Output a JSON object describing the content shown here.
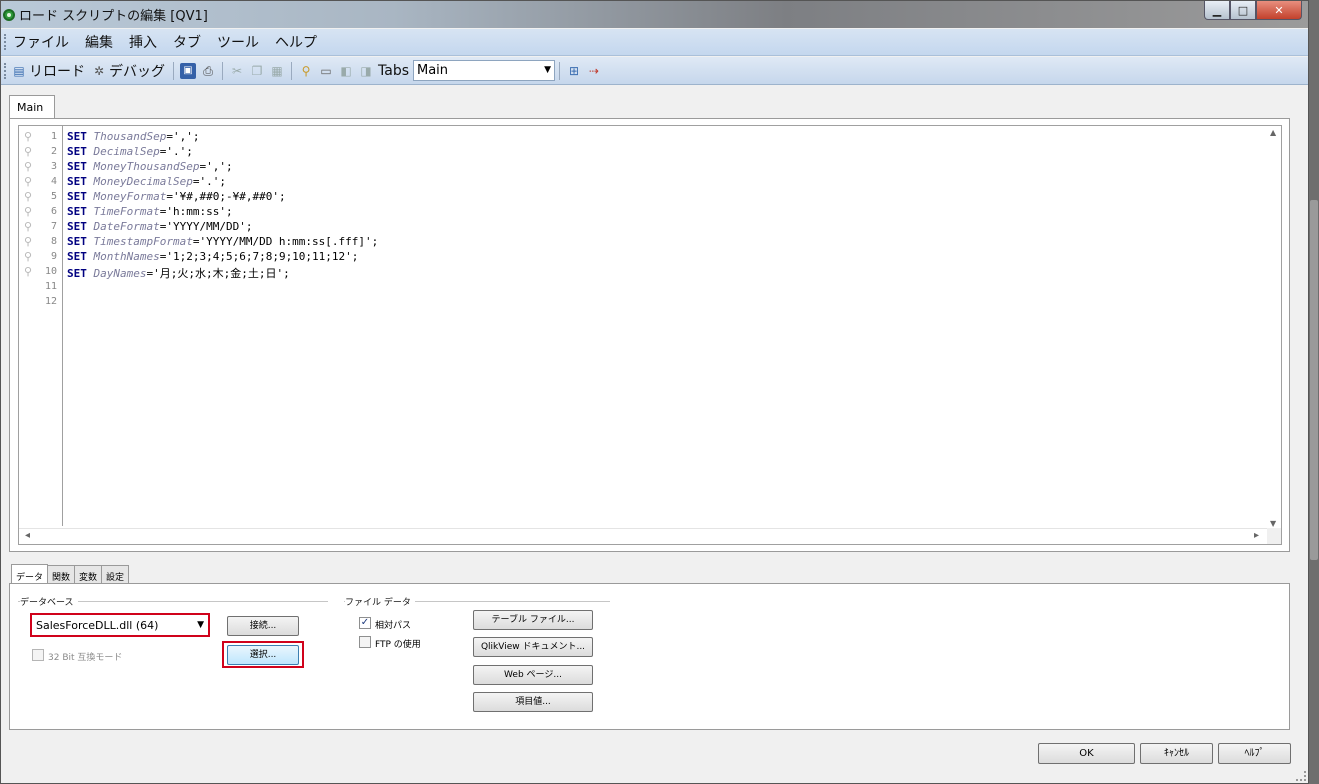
{
  "window": {
    "title": "ロード スクリプトの編集 [QV1]"
  },
  "menu": [
    "ファイル",
    "編集",
    "挿入",
    "タブ",
    "ツール",
    "ヘルプ"
  ],
  "toolbar": {
    "reload_label": "リロード",
    "debug_label": "デバッグ",
    "tabs_label": "Tabs",
    "tabs_selected": "Main"
  },
  "editor": {
    "tab_label": "Main",
    "lines": [
      {
        "num": "1",
        "kw": "SET",
        "var": "ThousandSep",
        "val": "=',';"
      },
      {
        "num": "2",
        "kw": "SET",
        "var": "DecimalSep",
        "val": "='.';"
      },
      {
        "num": "3",
        "kw": "SET",
        "var": "MoneyThousandSep",
        "val": "=',';"
      },
      {
        "num": "4",
        "kw": "SET",
        "var": "MoneyDecimalSep",
        "val": "='.';"
      },
      {
        "num": "5",
        "kw": "SET",
        "var": "MoneyFormat",
        "val": "='¥#,##0;-¥#,##0';"
      },
      {
        "num": "6",
        "kw": "SET",
        "var": "TimeFormat",
        "val": "='h:mm:ss';"
      },
      {
        "num": "7",
        "kw": "SET",
        "var": "DateFormat",
        "val": "='YYYY/MM/DD';"
      },
      {
        "num": "8",
        "kw": "SET",
        "var": "TimestampFormat",
        "val": "='YYYY/MM/DD h:mm:ss[.fff]';"
      },
      {
        "num": "9",
        "kw": "SET",
        "var": "MonthNames",
        "val": "='1;2;3;4;5;6;7;8;9;10;11;12';"
      },
      {
        "num": "10",
        "kw": "SET",
        "var": "DayNames",
        "val": "='月;火;水;木;金;土;日';"
      },
      {
        "num": "11",
        "kw": "",
        "var": "",
        "val": ""
      },
      {
        "num": "12",
        "kw": "",
        "var": "",
        "val": ""
      }
    ]
  },
  "bottom_tabs": [
    "データ",
    "関数",
    "変数",
    "設定"
  ],
  "data_panel": {
    "database_label": "データベース",
    "database_value": "SalesForceDLL.dll (64)",
    "connect_button": "接続...",
    "select_button": "選択...",
    "compat_mode_label": "32 Bit 互換モード",
    "file_data_label": "ファイル データ",
    "relative_path_label": "相対パス",
    "relative_path_checked": true,
    "ftp_label": "FTP の使用",
    "ftp_checked": false,
    "table_file_button": "テーブル ファイル...",
    "qlikview_doc_button": "QlikView ドキュメント...",
    "web_page_button": "Web ページ...",
    "field_value_button": "項目値..."
  },
  "dialog_buttons": {
    "ok": "OK",
    "cancel": "ｷｬﾝｾﾙ",
    "help": "ﾍﾙﾌﾟ"
  },
  "colors": {
    "keyword": "#000080",
    "variable": "#7a7a9a",
    "highlight": "#d0021b"
  }
}
